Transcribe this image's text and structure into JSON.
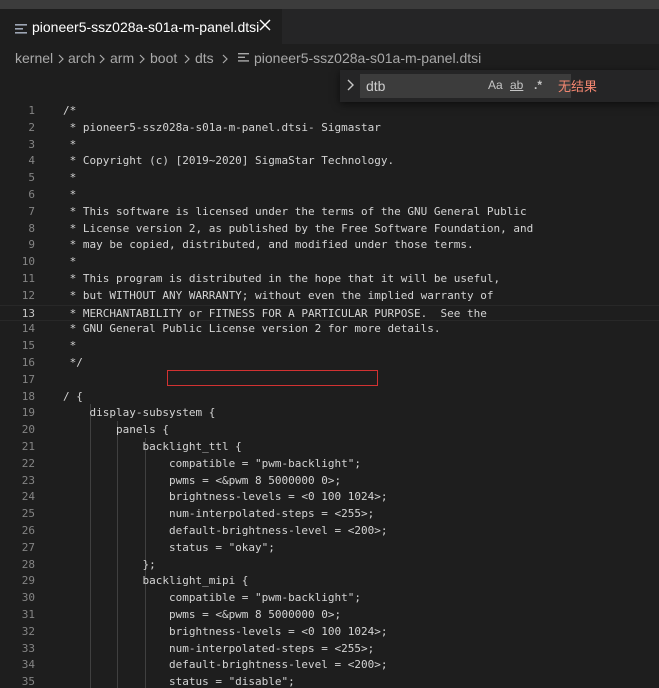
{
  "tab": {
    "title": "pioneer5-ssz028a-s01a-m-panel.dtsi",
    "close_icon": "close-icon",
    "file_icon": "list-icon"
  },
  "breadcrumb": {
    "items": [
      "kernel",
      "arch",
      "arm",
      "boot",
      "dts",
      "pioneer5-ssz028a-s01a-m-panel.dtsi"
    ]
  },
  "find": {
    "value": "dtb",
    "match_case": "Aa",
    "whole_word": "ab",
    "regex": ".*",
    "result": "无结果"
  },
  "colors": {
    "result_text": "#f48771",
    "highlight_border": "#d23232"
  },
  "editor": {
    "current_line": 13,
    "lines": [
      {
        "n": "1",
        "text": "/*"
      },
      {
        "n": "2",
        "text": " * pioneer5-ssz028a-s01a-m-panel.dtsi- Sigmastar"
      },
      {
        "n": "3",
        "text": " *"
      },
      {
        "n": "4",
        "text": " * Copyright (c) [2019~2020] SigmaStar Technology."
      },
      {
        "n": "5",
        "text": " *"
      },
      {
        "n": "6",
        "text": " *"
      },
      {
        "n": "7",
        "text": " * This software is licensed under the terms of the GNU General Public"
      },
      {
        "n": "8",
        "text": " * License version 2, as published by the Free Software Foundation, and"
      },
      {
        "n": "9",
        "text": " * may be copied, distributed, and modified under those terms."
      },
      {
        "n": "10",
        "text": " *"
      },
      {
        "n": "11",
        "text": " * This program is distributed in the hope that it will be useful,"
      },
      {
        "n": "12",
        "text": " * but WITHOUT ANY WARRANTY; without even the implied warranty of"
      },
      {
        "n": "13",
        "text": " * MERCHANTABILITY or FITNESS FOR A PARTICULAR PURPOSE.  See the"
      },
      {
        "n": "14",
        "text": " * GNU General Public License version 2 for more details."
      },
      {
        "n": "15",
        "text": " *"
      },
      {
        "n": "16",
        "text": " */"
      },
      {
        "n": "17",
        "text": ""
      },
      {
        "n": "18",
        "text": "/ {"
      },
      {
        "n": "19",
        "text": "    display-subsystem {"
      },
      {
        "n": "20",
        "text": "        panels {"
      },
      {
        "n": "21",
        "text": "            backlight_ttl {"
      },
      {
        "n": "22",
        "text": "                compatible = \"pwm-backlight\";"
      },
      {
        "n": "23",
        "text": "                pwms = <&pwm 8 5000000 0>;"
      },
      {
        "n": "24",
        "text": "                brightness-levels = <0 100 1024>;"
      },
      {
        "n": "25",
        "text": "                num-interpolated-steps = <255>;"
      },
      {
        "n": "26",
        "text": "                default-brightness-level = <200>;"
      },
      {
        "n": "27",
        "text": "                status = \"okay\";"
      },
      {
        "n": "28",
        "text": "            };"
      },
      {
        "n": "29",
        "text": "            backlight_mipi {"
      },
      {
        "n": "30",
        "text": "                compatible = \"pwm-backlight\";"
      },
      {
        "n": "31",
        "text": "                pwms = <&pwm 8 5000000 0>;"
      },
      {
        "n": "32",
        "text": "                brightness-levels = <0 100 1024>;"
      },
      {
        "n": "33",
        "text": "                num-interpolated-steps = <255>;"
      },
      {
        "n": "34",
        "text": "                default-brightness-level = <200>;"
      },
      {
        "n": "35",
        "text": "                status = \"disable\";"
      }
    ]
  }
}
